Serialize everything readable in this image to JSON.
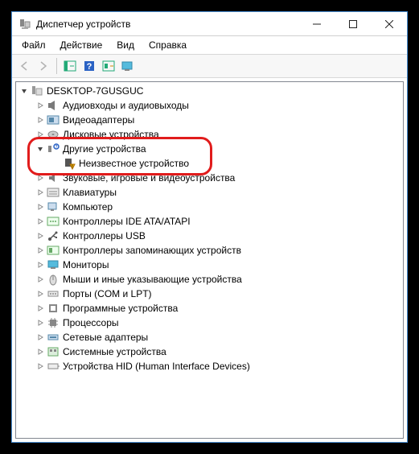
{
  "window": {
    "title": "Диспетчер устройств"
  },
  "menu": {
    "file": "Файл",
    "action": "Действие",
    "view": "Вид",
    "help": "Справка"
  },
  "tree": {
    "root": "DESKTOP-7GUSGUC",
    "items": [
      {
        "label": "Аудиовходы и аудиовыходы",
        "icon": "speaker"
      },
      {
        "label": "Видеоадаптеры",
        "icon": "display-card"
      },
      {
        "label": "Дисковые устройства",
        "icon": "disk",
        "cut": true
      },
      {
        "label": "Другие устройства",
        "icon": "other",
        "expanded": true,
        "children": [
          {
            "label": "Неизвестное устройство",
            "icon": "unknown-warn"
          }
        ]
      },
      {
        "label": "Звуковые, игровые и видеоустройства",
        "icon": "sound"
      },
      {
        "label": "Клавиатуры",
        "icon": "keyboard"
      },
      {
        "label": "Компьютер",
        "icon": "computer"
      },
      {
        "label": "Контроллеры IDE ATA/ATAPI",
        "icon": "ide"
      },
      {
        "label": "Контроллеры USB",
        "icon": "usb"
      },
      {
        "label": "Контроллеры запоминающих устройств",
        "icon": "storage"
      },
      {
        "label": "Мониторы",
        "icon": "monitor"
      },
      {
        "label": "Мыши и иные указывающие устройства",
        "icon": "mouse"
      },
      {
        "label": "Порты (COM и LPT)",
        "icon": "port"
      },
      {
        "label": "Программные устройства",
        "icon": "software"
      },
      {
        "label": "Процессоры",
        "icon": "cpu"
      },
      {
        "label": "Сетевые адаптеры",
        "icon": "network"
      },
      {
        "label": "Системные устройства",
        "icon": "system"
      },
      {
        "label": "Устройства HID (Human Interface Devices)",
        "icon": "hid"
      }
    ]
  }
}
